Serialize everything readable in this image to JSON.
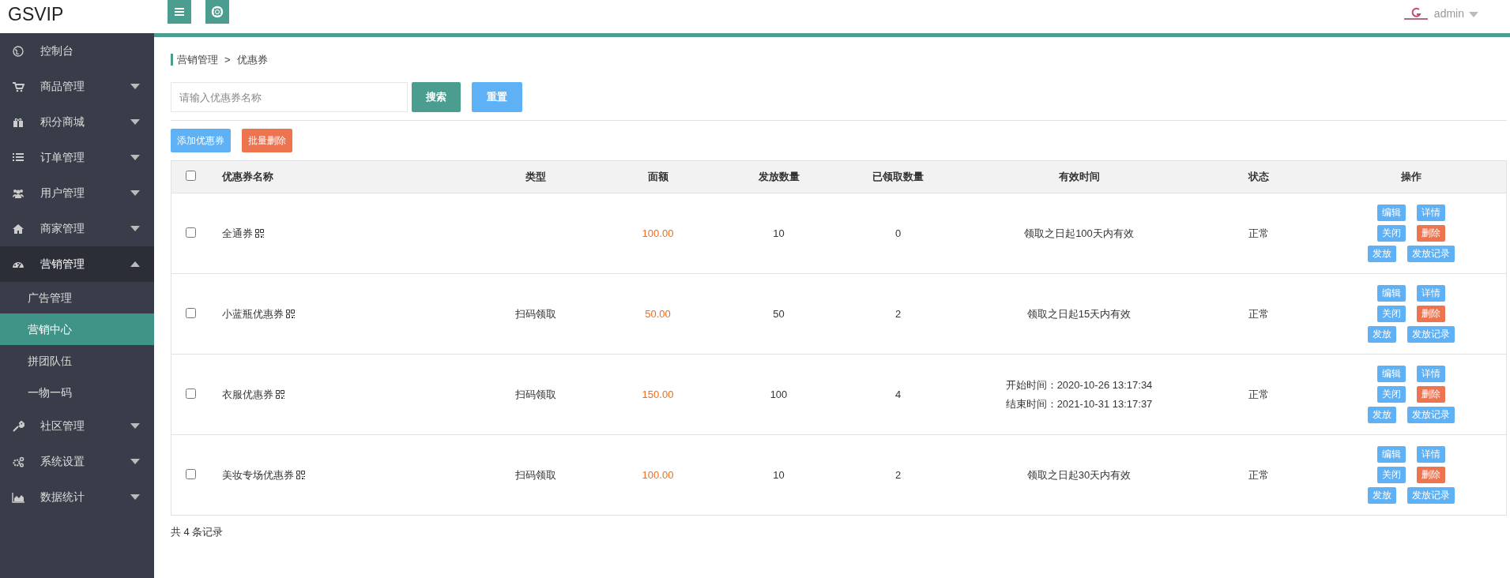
{
  "header": {
    "logo": "GSVIP",
    "user": "admin"
  },
  "sidebar": {
    "items": [
      {
        "label": "控制台"
      },
      {
        "label": "商品管理",
        "expanded": false
      },
      {
        "label": "积分商城",
        "expanded": false
      },
      {
        "label": "订单管理",
        "expanded": false
      },
      {
        "label": "用户管理",
        "expanded": false
      },
      {
        "label": "商家管理",
        "expanded": false
      },
      {
        "label": "营销管理",
        "expanded": true,
        "children": [
          {
            "label": "广告管理",
            "selected": false
          },
          {
            "label": "营销中心",
            "selected": true
          },
          {
            "label": "拼团队伍",
            "selected": false
          },
          {
            "label": "一物一码",
            "selected": false
          }
        ]
      },
      {
        "label": "社区管理",
        "expanded": false
      },
      {
        "label": "系统设置",
        "expanded": false
      },
      {
        "label": "数据统计",
        "expanded": false
      }
    ]
  },
  "breadcrumb": [
    "营销管理",
    ">",
    "优惠券"
  ],
  "search": {
    "placeholder": "请输入优惠券名称",
    "buttons": [
      "搜索",
      "重置"
    ]
  },
  "toolbar": [
    "添加优惠券",
    "批量删除"
  ],
  "table": {
    "columns": [
      "优惠券名称",
      "类型",
      "面额",
      "发放数量",
      "已领取数量",
      "有效时间",
      "状态",
      "操作"
    ],
    "rows": [
      {
        "checked": false,
        "name": "全通券",
        "type": "",
        "amount": "100.00",
        "issued": "10",
        "claimed": "0",
        "validity": [
          "领取之日起100天内有效"
        ],
        "status": "正常",
        "actions": [
          [
            {
              "label": "编辑",
              "kind": "normal"
            },
            {
              "label": "详情",
              "kind": "normal"
            }
          ],
          [
            {
              "label": "关闭",
              "kind": "normal"
            },
            {
              "label": "删除",
              "kind": "danger"
            }
          ],
          [
            {
              "label": "发放",
              "kind": "normal"
            },
            {
              "label": "发放记录",
              "kind": "normal"
            }
          ]
        ]
      },
      {
        "checked": false,
        "name": "小蓝瓶优惠券",
        "type": "扫码领取",
        "amount": "50.00",
        "issued": "50",
        "claimed": "2",
        "validity": [
          "领取之日起15天内有效"
        ],
        "status": "正常",
        "actions": [
          [
            {
              "label": "编辑",
              "kind": "normal"
            },
            {
              "label": "详情",
              "kind": "normal"
            }
          ],
          [
            {
              "label": "关闭",
              "kind": "normal"
            },
            {
              "label": "删除",
              "kind": "danger"
            }
          ],
          [
            {
              "label": "发放",
              "kind": "normal"
            },
            {
              "label": "发放记录",
              "kind": "normal"
            }
          ]
        ]
      },
      {
        "checked": false,
        "name": "衣服优惠券",
        "type": "扫码领取",
        "amount": "150.00",
        "issued": "100",
        "claimed": "4",
        "validity": [
          "开始时间：2020-10-26 13:17:34",
          "结束时间：2021-10-31 13:17:37"
        ],
        "status": "正常",
        "actions": [
          [
            {
              "label": "编辑",
              "kind": "normal"
            },
            {
              "label": "详情",
              "kind": "normal"
            }
          ],
          [
            {
              "label": "关闭",
              "kind": "normal"
            },
            {
              "label": "删除",
              "kind": "danger"
            }
          ],
          [
            {
              "label": "发放",
              "kind": "normal"
            },
            {
              "label": "发放记录",
              "kind": "normal"
            }
          ]
        ]
      },
      {
        "checked": false,
        "name": "美妆专场优惠券",
        "type": "扫码领取",
        "amount": "100.00",
        "issued": "10",
        "claimed": "2",
        "validity": [
          "领取之日起30天内有效"
        ],
        "status": "正常",
        "actions": [
          [
            {
              "label": "编辑",
              "kind": "normal"
            },
            {
              "label": "详情",
              "kind": "normal"
            }
          ],
          [
            {
              "label": "关闭",
              "kind": "normal"
            },
            {
              "label": "删除",
              "kind": "danger"
            }
          ],
          [
            {
              "label": "发放",
              "kind": "normal"
            },
            {
              "label": "发放记录",
              "kind": "normal"
            }
          ]
        ]
      }
    ],
    "header_checked": false
  },
  "footer": "共 4 条记录"
}
